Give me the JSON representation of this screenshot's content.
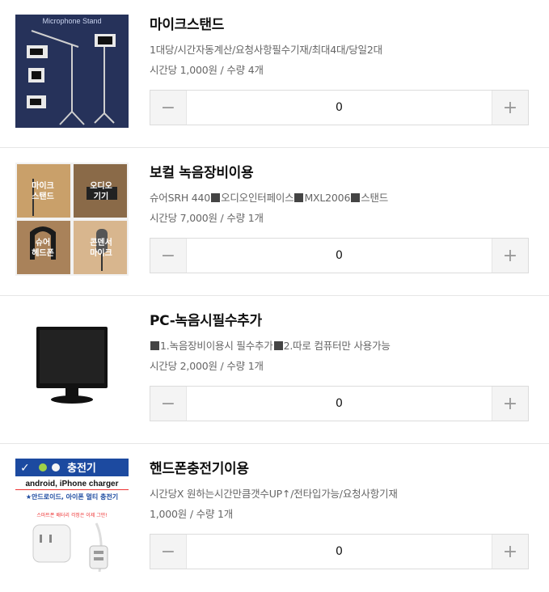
{
  "products": [
    {
      "title": "마이크스탠드",
      "description": "1대당/시간자동계산/요청사항필수기재/최대4대/당일2대",
      "price": "시간당 1,000원 / 수량 4개",
      "quantity": "0",
      "thumb_caption": "Microphone Stand",
      "minus_icon": "minus-icon",
      "plus_icon": "plus-icon"
    },
    {
      "title": "보컬 녹음장비이용",
      "description_parts": [
        "슈어SRH 440",
        "오디오인터페이스",
        "MXL2006",
        "스탠드"
      ],
      "price": "시간당 7,000원 / 수량 1개",
      "quantity": "0",
      "thumb_labels": [
        "마이크\n스탠드",
        "오디오\n기기",
        "슈어\n헤드폰",
        "콘덴서\n마이크"
      ]
    },
    {
      "title": "PC-녹음시필수추가",
      "description_parts": [
        "",
        "1.녹음장비이용시 필수추가",
        "2.따로 컴퓨터만 사용가능"
      ],
      "price": "시간당 2,000원 / 수량 1개",
      "quantity": "0"
    },
    {
      "title": "핸드폰충전기이용",
      "description": "시간당X 원하는시간만큼갯수UP↑/전타입가능/요청사항기재",
      "price": "1,000원 / 수량 1개",
      "quantity": "0",
      "thumb_banner": "충전기",
      "thumb_sub": "android, iPhone charger",
      "thumb_note": "★안드로이드, 아이폰 멀티 충전기",
      "thumb_note2": "스마트폰 배터리 걱정은 이제 그만!"
    }
  ],
  "colors": {
    "border": "#dcdcdc",
    "button_bg": "#f4f4f4",
    "title": "#111111",
    "muted": "#666666"
  }
}
